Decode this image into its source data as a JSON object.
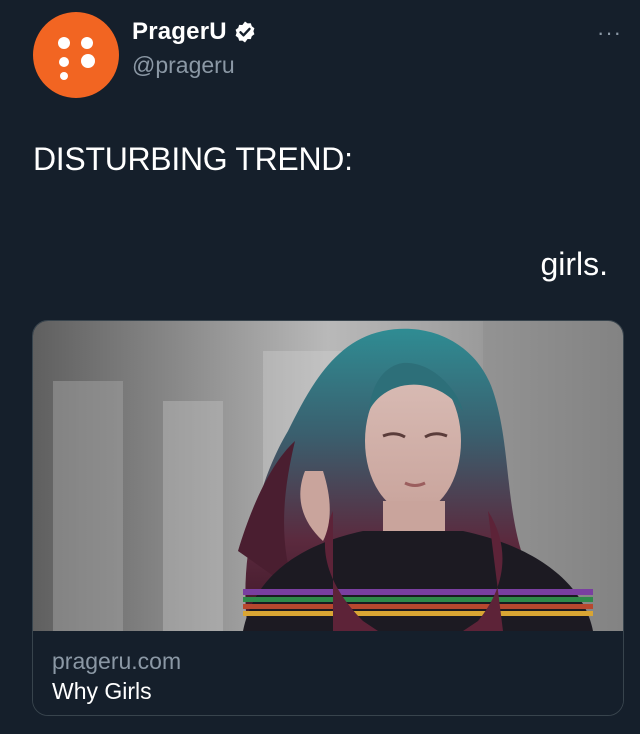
{
  "author": {
    "display_name": "PragerU",
    "handle": "@prageru",
    "avatar_color": "#f26522",
    "verified": true,
    "verified_icon": "verified-badge-icon"
  },
  "more_menu": {
    "label": "···",
    "icon": "more-options-icon"
  },
  "tweet": {
    "line1": "DISTURBING TREND:",
    "line2": "girls."
  },
  "link_card": {
    "domain": "prageru.com",
    "title": "Why Girls",
    "image": "photo of a young woman with teal and purple hair looking down"
  },
  "colors": {
    "background": "#151f2b",
    "secondary_text": "#8b98a5",
    "border": "#38444d",
    "brand": "#f26522"
  }
}
